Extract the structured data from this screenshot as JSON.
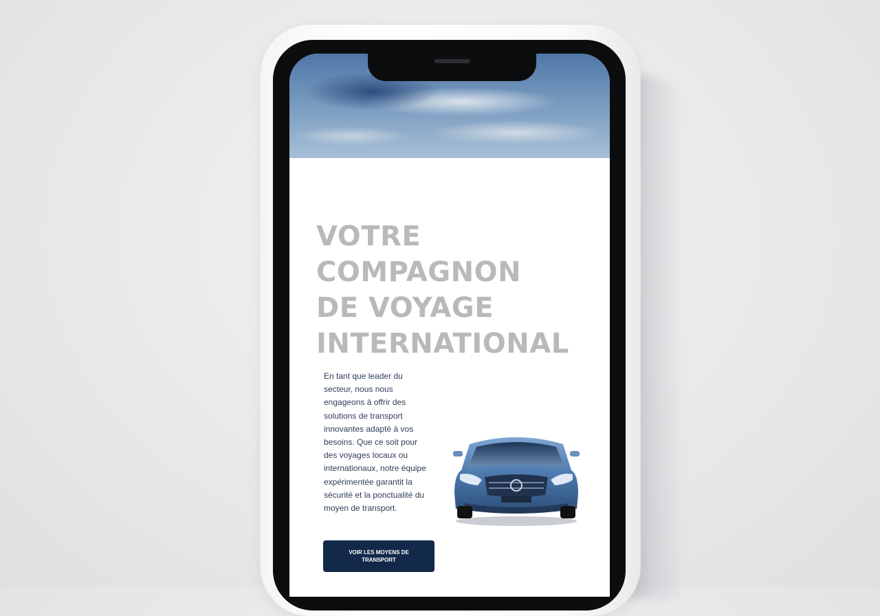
{
  "hero": {
    "headline_lines": [
      "VOTRE",
      "COMPAGNON",
      "DE VOYAGE",
      "INTERNATIONAL"
    ],
    "description": "En tant que leader du secteur, nous nous engageons à offrir des solutions de transport innovantes adapté à vos besoins. Que ce soit pour des voyages locaux ou internationaux, notre équipe expérimentée garantit la sécurité et la ponctualité du moyen de transport.",
    "cta_label": "VOIR LES MOYENS DE TRANSPORT"
  },
  "colors": {
    "headline": "#b9b9bb",
    "body_text": "#2f3d57",
    "cta_background": "#13294a",
    "phone_frame": "#0c0d0f"
  },
  "icons": {
    "car_image": "car-icon"
  }
}
